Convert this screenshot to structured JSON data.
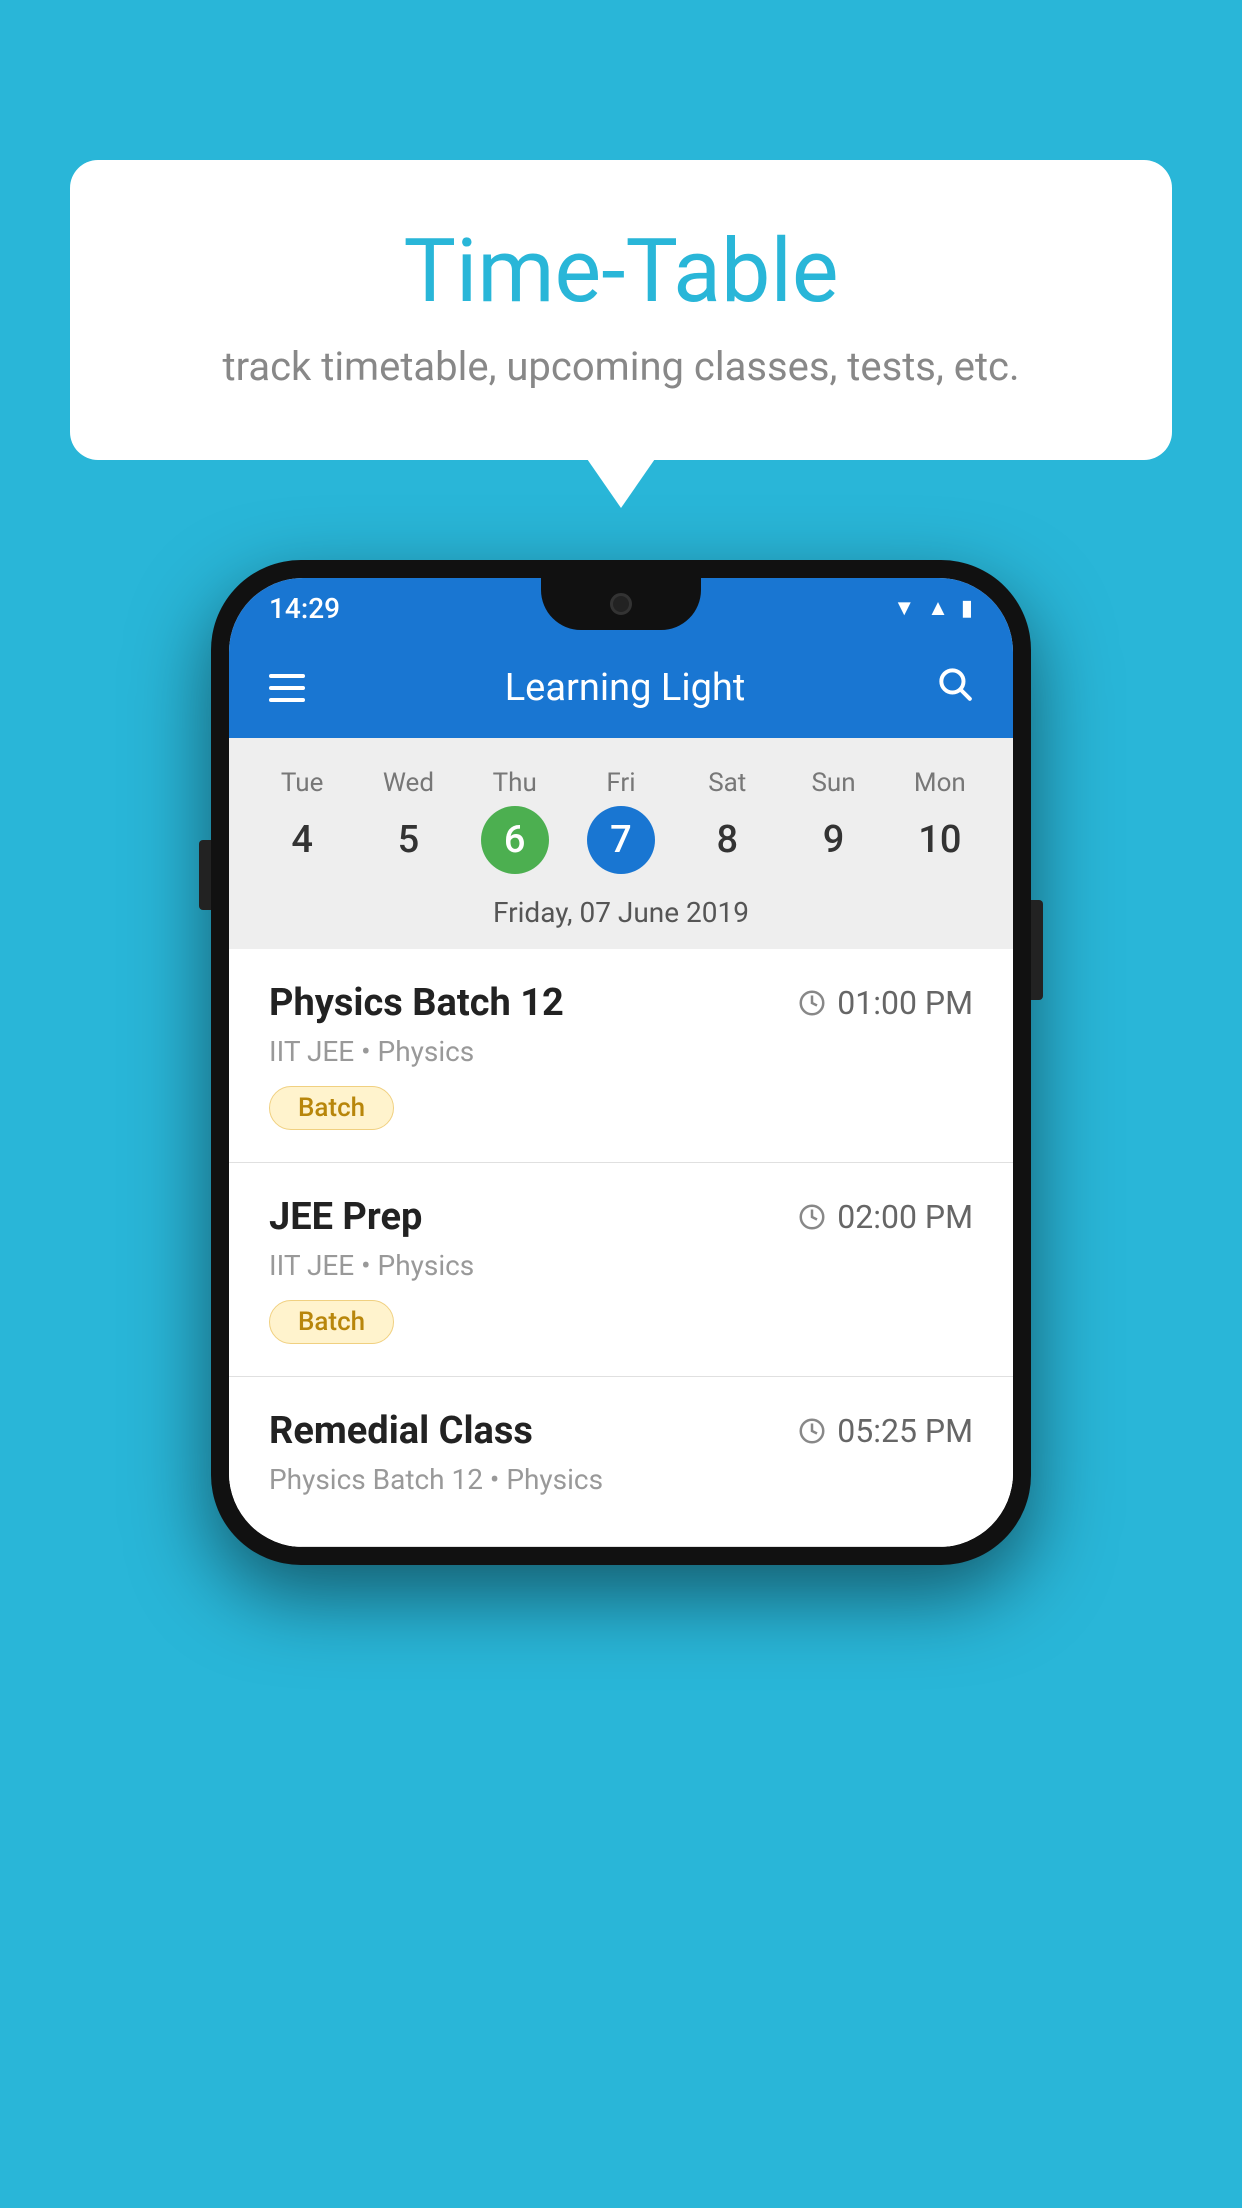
{
  "background_color": "#29b6d8",
  "speech_bubble": {
    "title": "Time-Table",
    "subtitle": "track timetable, upcoming classes, tests, etc."
  },
  "phone": {
    "status_bar": {
      "time": "14:29"
    },
    "app_bar": {
      "title": "Learning Light"
    },
    "calendar": {
      "days": [
        {
          "name": "Tue",
          "num": "4",
          "state": "normal"
        },
        {
          "name": "Wed",
          "num": "5",
          "state": "normal"
        },
        {
          "name": "Thu",
          "num": "6",
          "state": "today"
        },
        {
          "name": "Fri",
          "num": "7",
          "state": "selected"
        },
        {
          "name": "Sat",
          "num": "8",
          "state": "normal"
        },
        {
          "name": "Sun",
          "num": "9",
          "state": "normal"
        },
        {
          "name": "Mon",
          "num": "10",
          "state": "normal"
        }
      ],
      "selected_date_label": "Friday, 07 June 2019"
    },
    "classes": [
      {
        "name": "Physics Batch 12",
        "time": "01:00 PM",
        "meta": "IIT JEE • Physics",
        "badge": "Batch"
      },
      {
        "name": "JEE Prep",
        "time": "02:00 PM",
        "meta": "IIT JEE • Physics",
        "badge": "Batch"
      },
      {
        "name": "Remedial Class",
        "time": "05:25 PM",
        "meta": "Physics Batch 12 • Physics",
        "badge": null
      }
    ]
  },
  "icons": {
    "hamburger": "☰",
    "search": "🔍",
    "clock": "🕐"
  }
}
